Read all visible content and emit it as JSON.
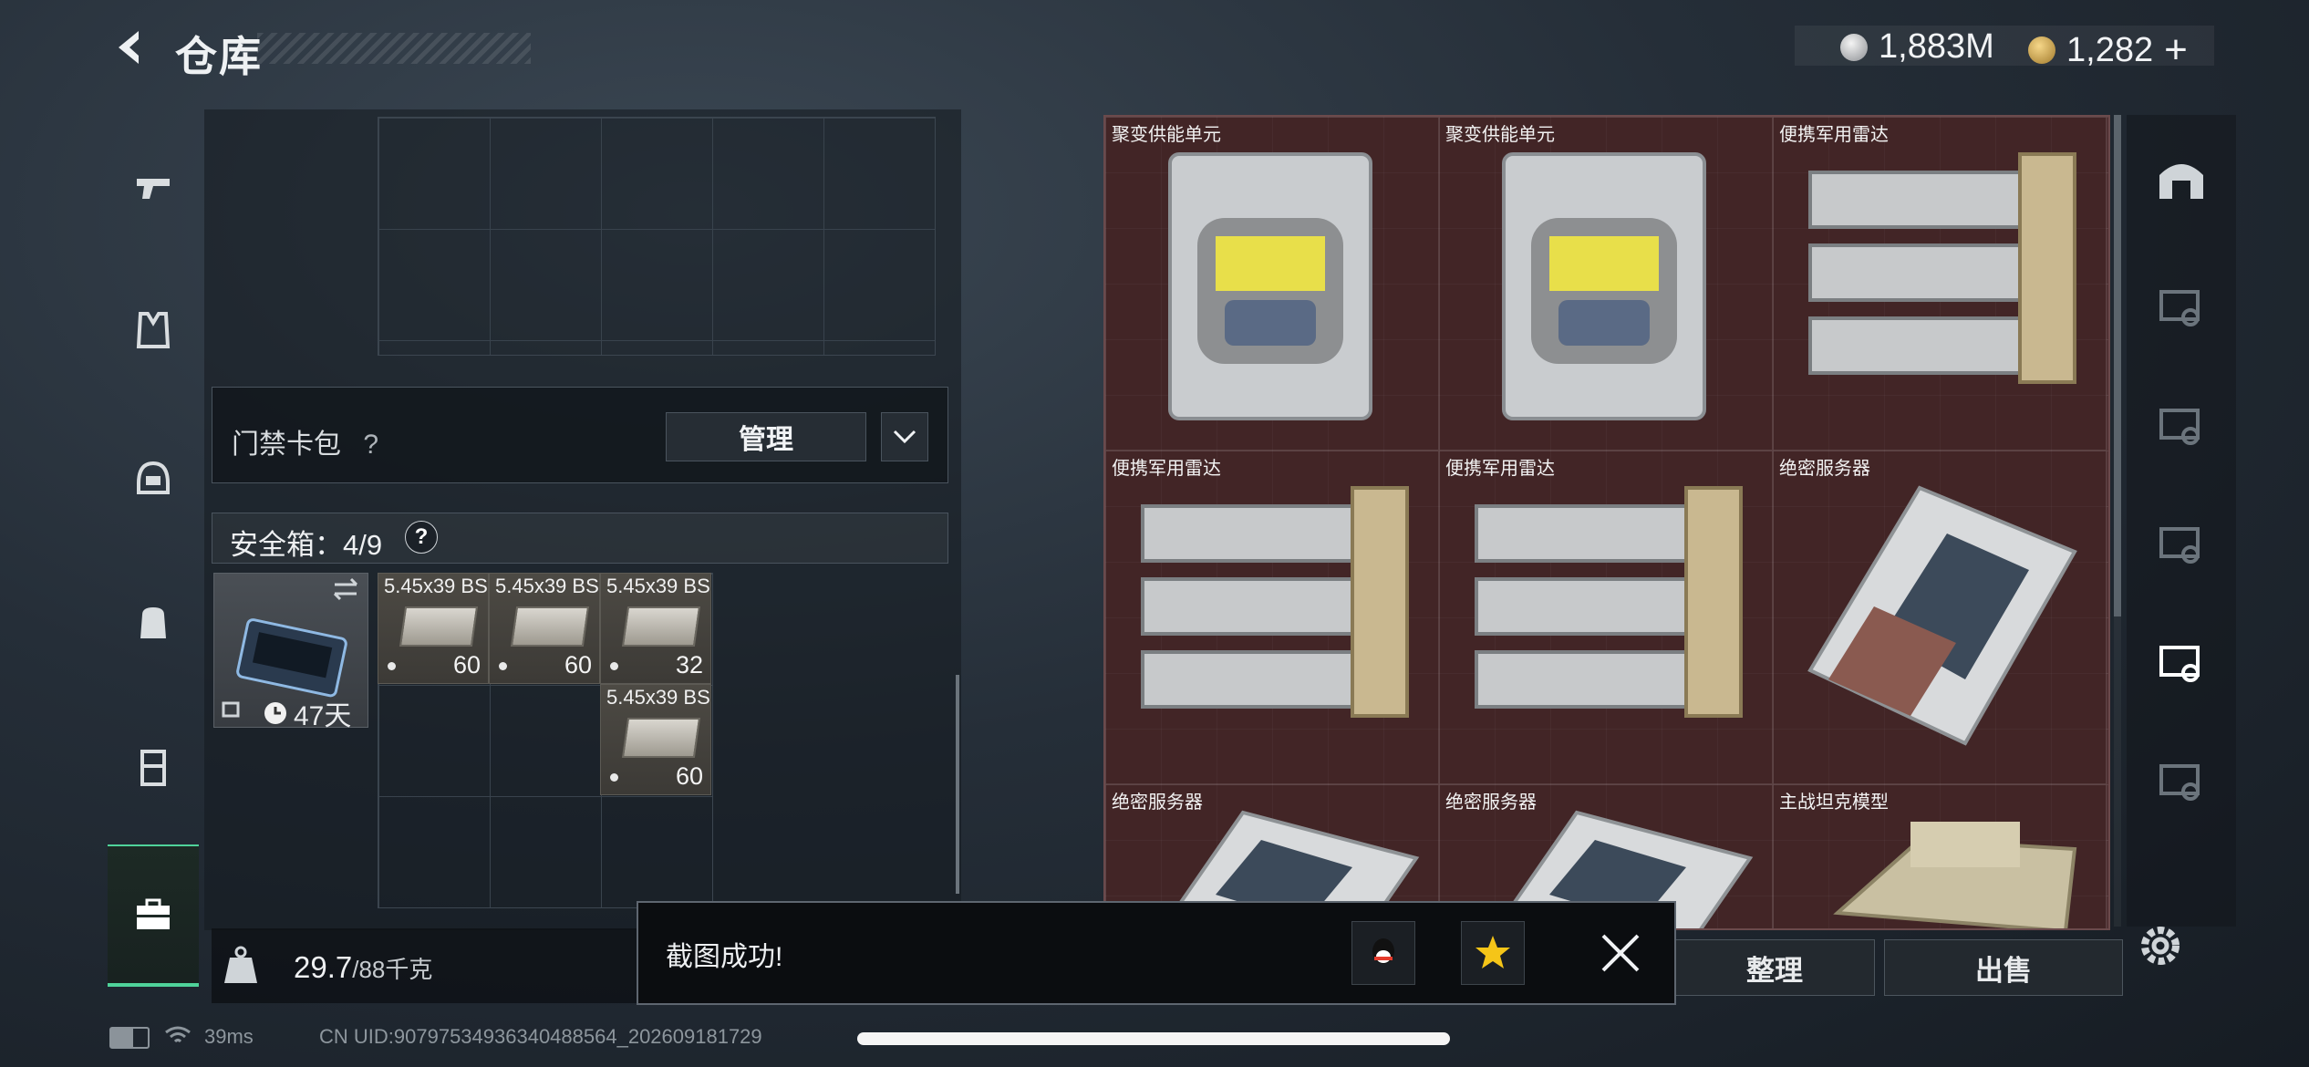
{
  "header": {
    "title": "仓库"
  },
  "currency": {
    "silver": "1,883M",
    "gold": "1,282",
    "add_label": "+"
  },
  "left_nav": [
    "weapon",
    "armor",
    "helmet",
    "backpack",
    "rig",
    "storage"
  ],
  "keycard": {
    "label": "门禁卡包",
    "help": "?",
    "manage_label": "管理"
  },
  "safebox": {
    "label": "安全箱：4/9",
    "help": "?",
    "days_left": "47天",
    "ammo": [
      {
        "name": "5.45x39 BS",
        "count": "60"
      },
      {
        "name": "5.45x39 BS",
        "count": "60"
      },
      {
        "name": "5.45x39 BS",
        "count": "32"
      },
      {
        "name": "5.45x39 BS",
        "count": "60"
      }
    ]
  },
  "weight": {
    "current": "29.7",
    "max": "/88千克"
  },
  "stash_items": [
    {
      "label": "聚变供能单元"
    },
    {
      "label": "聚变供能单元"
    },
    {
      "label": "便携军用雷达"
    },
    {
      "label": "便携军用雷达"
    },
    {
      "label": "便携军用雷达"
    },
    {
      "label": "绝密服务器"
    },
    {
      "label": "绝密服务器"
    },
    {
      "label": "绝密服务器"
    },
    {
      "label": "主战坦克模型"
    }
  ],
  "actions": {
    "sort_label": "整理",
    "sell_label": "出售"
  },
  "toast": {
    "message": "截图成功!"
  },
  "status": {
    "ping": "39ms",
    "uid": "CN UID:9079753493634048856‍4_202609181729"
  },
  "colors": {
    "accent_green": "#4fd39a",
    "stash_bg": "#4a2a2c"
  }
}
